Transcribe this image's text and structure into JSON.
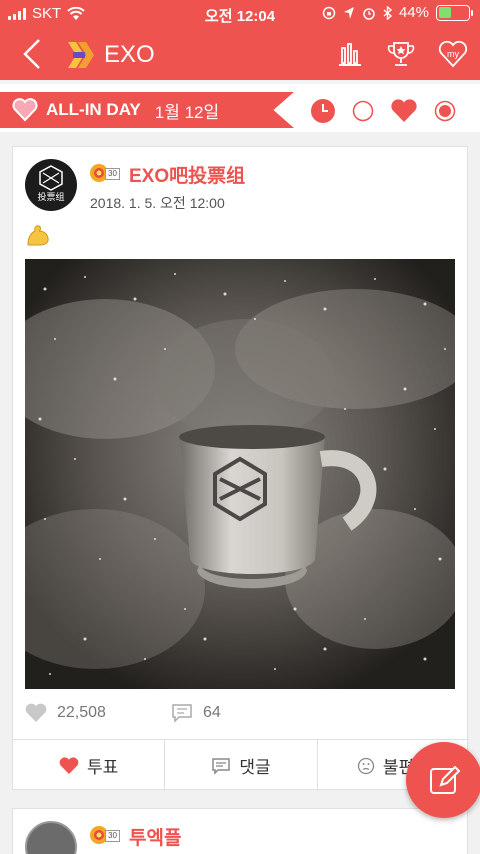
{
  "status_bar": {
    "carrier": "SKT",
    "time": "오전 12:04",
    "battery": "44%",
    "battery_level": 0.44
  },
  "nav": {
    "title": "EXO",
    "back_icon": "chevron-left-icon",
    "icons": [
      "bar-chart-icon",
      "trophy-icon",
      "my-heart-icon"
    ]
  },
  "day_band": {
    "label": "ALL-IN DAY",
    "date": "1월 12일",
    "icons": [
      "clock-icon",
      "empty-circle-icon",
      "heart-icon",
      "record-icon"
    ]
  },
  "post": {
    "badge_level": "30",
    "author": "EXO吧投票组",
    "timestamp": "2018. 1. 5. 오전 12:00",
    "emoji": "flexed-biceps-icon",
    "likes": "22,508",
    "comments": "64",
    "actions": [
      {
        "label": "투표",
        "icon": "heart-icon"
      },
      {
        "label": "댓글",
        "icon": "comment-icon"
      },
      {
        "label": "불편해",
        "icon": "frown-icon"
      }
    ],
    "avatar_text": "投票组"
  },
  "next_post": {
    "badge_level": "30",
    "author": "투엑플"
  },
  "colors": {
    "accent": "#ef5350"
  }
}
